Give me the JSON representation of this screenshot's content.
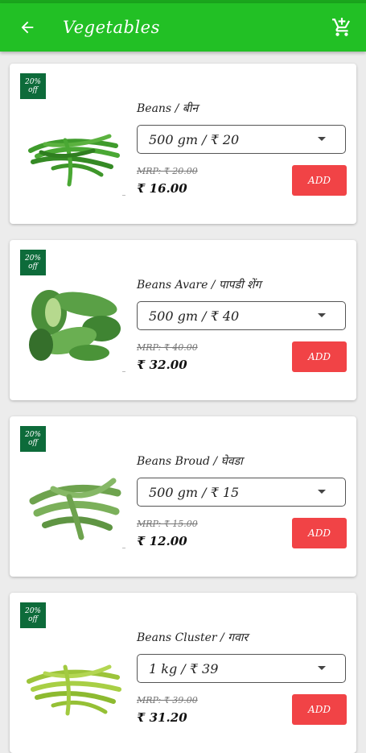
{
  "header": {
    "title": "Vegetables",
    "back_icon": "arrow-left-icon",
    "cart_icon": "cart-plus-icon"
  },
  "theme": {
    "app_bar": "#22c025",
    "badge": "#0d6b3a",
    "add_button": "#f14346"
  },
  "products": [
    {
      "badge_line1": "20%",
      "badge_line2": "off",
      "name": "Beans / बीन",
      "variant": "500 gm / ₹ 20",
      "mrp": "MRP: ₹ 20.00",
      "price": "₹ 16.00",
      "add_label": "ADD",
      "image": "green-beans"
    },
    {
      "badge_line1": "20%",
      "badge_line2": "off",
      "name": "Beans Avare / पापडी शेंग",
      "variant": "500 gm / ₹ 40",
      "mrp": "MRP: ₹ 40.00",
      "price": "₹ 32.00",
      "add_label": "ADD",
      "image": "avare-pods"
    },
    {
      "badge_line1": "20%",
      "badge_line2": "off",
      "name": "Beans Broud / घेवडा",
      "variant": "500 gm / ₹ 15",
      "mrp": "MRP: ₹ 15.00",
      "price": "₹ 12.00",
      "add_label": "ADD",
      "image": "broad-beans"
    },
    {
      "badge_line1": "20%",
      "badge_line2": "off",
      "name": "Beans Cluster / गवार",
      "variant": "1 kg / ₹ 39",
      "mrp": "MRP: ₹ 39.00",
      "price": "₹ 31.20",
      "add_label": "ADD",
      "image": "cluster-beans"
    }
  ]
}
